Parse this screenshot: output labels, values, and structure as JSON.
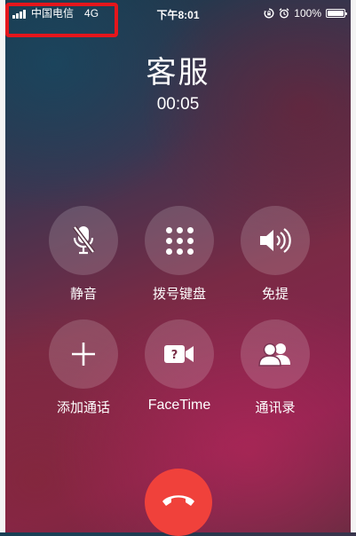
{
  "status_bar": {
    "carrier": "中国电信",
    "network": "4G",
    "time": "下午8:01",
    "battery": "100%",
    "battery_level": 1.0,
    "icons": [
      "signal-icon",
      "rotation-lock-icon",
      "alarm-icon",
      "battery-icon"
    ]
  },
  "call": {
    "caller_name": "客服",
    "duration": "00:05"
  },
  "buttons": {
    "mute": {
      "label": "静音",
      "icon": "microphone-muted-icon"
    },
    "keypad": {
      "label": "拨号键盘",
      "icon": "keypad-icon"
    },
    "speaker": {
      "label": "免提",
      "icon": "speaker-icon"
    },
    "add_call": {
      "label": "添加通话",
      "icon": "plus-icon"
    },
    "facetime": {
      "label": "FaceTime",
      "icon": "facetime-camera-icon"
    },
    "contacts": {
      "label": "通讯录",
      "icon": "contacts-icon"
    },
    "end_call": {
      "icon": "end-call-icon"
    }
  },
  "colors": {
    "end_call": "#f0413b",
    "highlight": "#e5161c"
  }
}
